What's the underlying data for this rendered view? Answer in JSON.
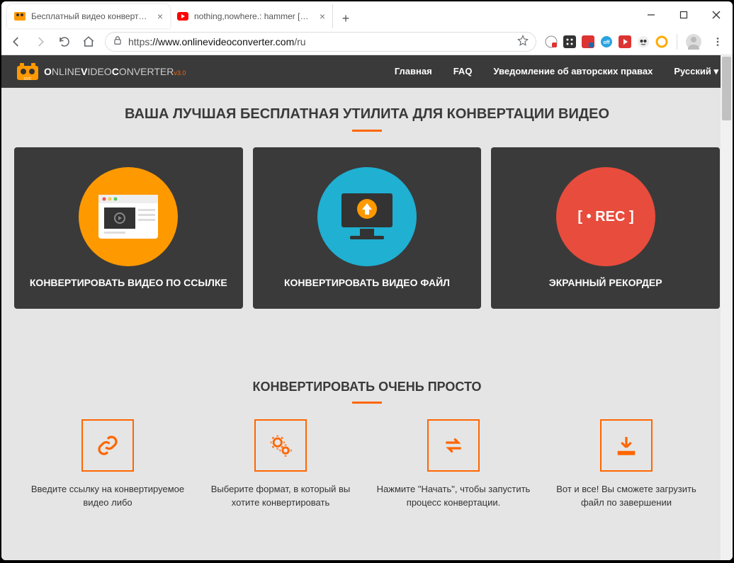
{
  "window": {
    "tabs": [
      {
        "title": "Бесплатный видео конвертер онлайн",
        "active": true,
        "favicon": "ovc"
      },
      {
        "title": "nothing,nowhere.: hammer [OFFICIAL]",
        "active": false,
        "favicon": "youtube"
      }
    ],
    "controls": {
      "minimize": "—",
      "maximize": "□",
      "close": "✕"
    }
  },
  "browser": {
    "url_protocol": "https",
    "url_host": "://www.onlinevideoconverter.com",
    "url_path": "/ru"
  },
  "site": {
    "logo_main": "OnlineVideoConverter",
    "logo_version": "v3.0",
    "nav": {
      "home": "Главная",
      "faq": "FAQ",
      "copyright": "Уведомление об авторских правах",
      "lang": "Русский"
    }
  },
  "hero": {
    "title": "ВАША ЛУЧШАЯ БЕСПЛАТНАЯ УТИЛИТА ДЛЯ КОНВЕРТАЦИИ ВИДЕО"
  },
  "cards": [
    {
      "label": "КОНВЕРТИРОВАТЬ ВИДЕО ПО ССЫЛКЕ"
    },
    {
      "label": "КОНВЕРТИРОВАТЬ ВИДЕО ФАЙЛ"
    },
    {
      "label": "ЭКРАННЫЙ РЕКОРДЕР"
    }
  ],
  "section2": {
    "title": "КОНВЕРТИРОВАТЬ ОЧЕНЬ ПРОСТО"
  },
  "steps": [
    {
      "text": "Введите ссылку на конвертируемое видео либо"
    },
    {
      "text": "Выберите формат, в который вы хотите конвертировать"
    },
    {
      "text": "Нажмите \"Начать\", чтобы запустить процесс конвертации."
    },
    {
      "text": "Вот и все! Вы сможете загрузить файл по завершении"
    }
  ]
}
